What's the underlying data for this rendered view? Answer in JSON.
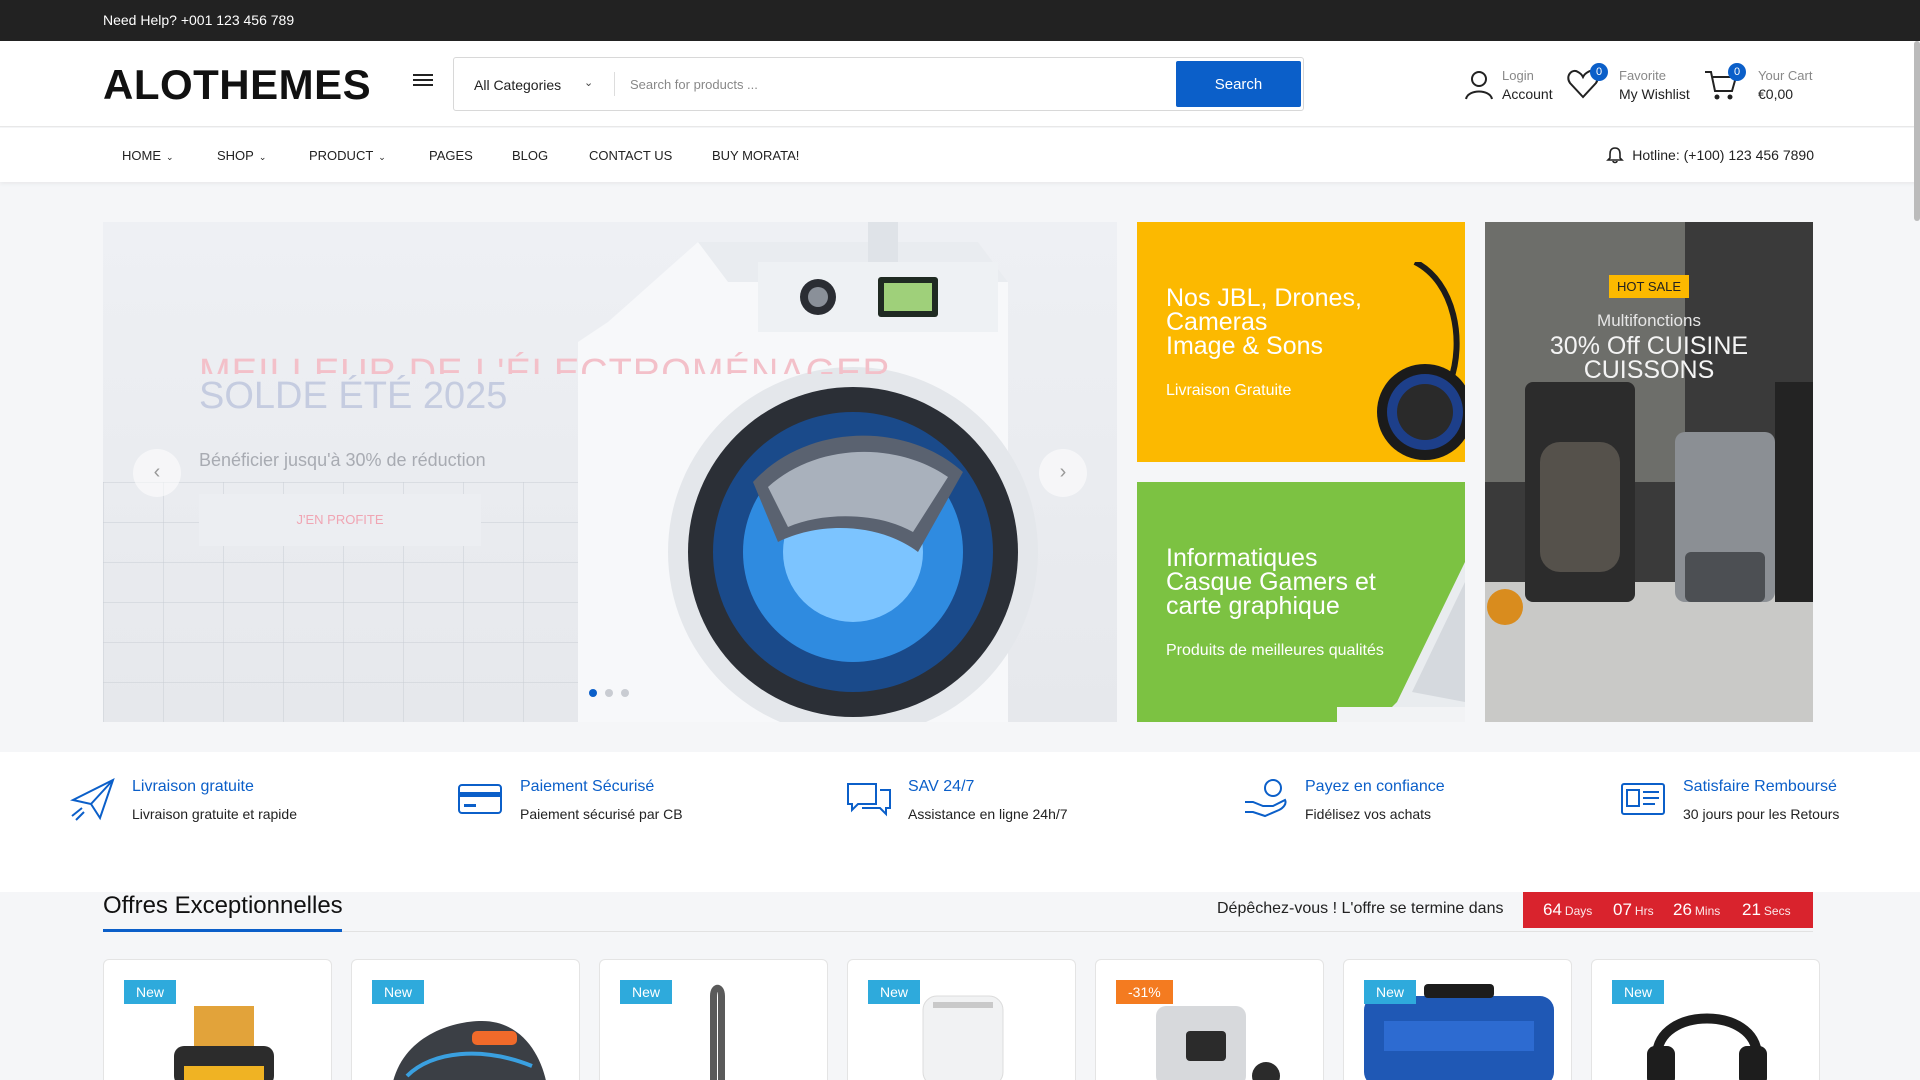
{
  "topbar": {
    "help_text": "Need Help? +001 123 456 789"
  },
  "header": {
    "logo": "ALOTHEMES",
    "search": {
      "category_selected": "All Categories",
      "placeholder": "Search for products ...",
      "button_label": "Search"
    },
    "account": {
      "small": "Login",
      "big": "Account"
    },
    "wishlist": {
      "small": "Favorite",
      "big": "My Wishlist",
      "count": "0"
    },
    "cart": {
      "small": "Your Cart",
      "big": "€0,00",
      "count": "0"
    }
  },
  "nav": {
    "items": [
      "HOME",
      "SHOP",
      "PRODUCT",
      "PAGES",
      "BLOG",
      "CONTACT US",
      "BUY MORATA!"
    ],
    "hotline": "Hotline: (+100) 123 456 7890"
  },
  "hero": {
    "kicker": "MEILLEUR DE L'ÉLECTROMÉNAGER",
    "title": "SOLDE ÉTÉ 2025",
    "subtitle": "Bénéficier jusqu'à 30% de réduction",
    "cta": "J'EN PROFITE",
    "prev_icon": "‹",
    "next_icon": "›",
    "slide_count": 3,
    "active_slide": 0
  },
  "banners": [
    {
      "title_lines": [
        "Nos JBL, Drones,",
        "Cameras",
        "Image & Sons"
      ],
      "subtitle": "Livraison Gratuite",
      "color": "#fcb900"
    },
    {
      "title_lines": [
        "Informatiques",
        "Casque Gamers et",
        "carte graphique"
      ],
      "subtitle": "Produits de meilleures qualités",
      "color": "#7cc242"
    },
    {
      "badge": "HOT SALE",
      "line1": "Multifonctions",
      "title_lines": [
        "30% Off CUISINE",
        "CUISSONS"
      ]
    }
  ],
  "features": [
    {
      "title": "Livraison gratuite",
      "desc": "Livraison gratuite et rapide",
      "icon": "paper-plane-icon"
    },
    {
      "title": "Paiement Sécurisé",
      "desc": "Paiement sécurisé par CB",
      "icon": "credit-card-icon"
    },
    {
      "title": "SAV 24/7",
      "desc": "Assistance en ligne 24h/7",
      "icon": "chat-icon"
    },
    {
      "title": "Payez en confiance",
      "desc": "Fidélisez vos achats",
      "icon": "hand-coin-icon"
    },
    {
      "title": "Satisfaire Remboursé",
      "desc": "30 jours pour les Retours",
      "icon": "id-card-icon"
    }
  ],
  "deals": {
    "title": "Offres Exceptionnelles",
    "hurry": "Dépêchez-vous ! L'offre se termine dans",
    "countdown": [
      {
        "value": "64",
        "unit": "Days"
      },
      {
        "value": "07",
        "unit": "Hrs"
      },
      {
        "value": "26",
        "unit": "Mins"
      },
      {
        "value": "21",
        "unit": "Secs"
      }
    ],
    "products": [
      {
        "tag": "New",
        "type": "new"
      },
      {
        "tag": "New",
        "type": "new"
      },
      {
        "tag": "New",
        "type": "new"
      },
      {
        "tag": "New",
        "type": "new"
      },
      {
        "tag": "-31%",
        "type": "sale"
      },
      {
        "tag": "New",
        "type": "new"
      },
      {
        "tag": "New",
        "type": "new"
      }
    ]
  },
  "colors": {
    "accent": "#0b5fc9",
    "topbar": "#222222",
    "sale": "#f47b20",
    "new": "#2eaadc",
    "countdown": "#d9232d"
  }
}
